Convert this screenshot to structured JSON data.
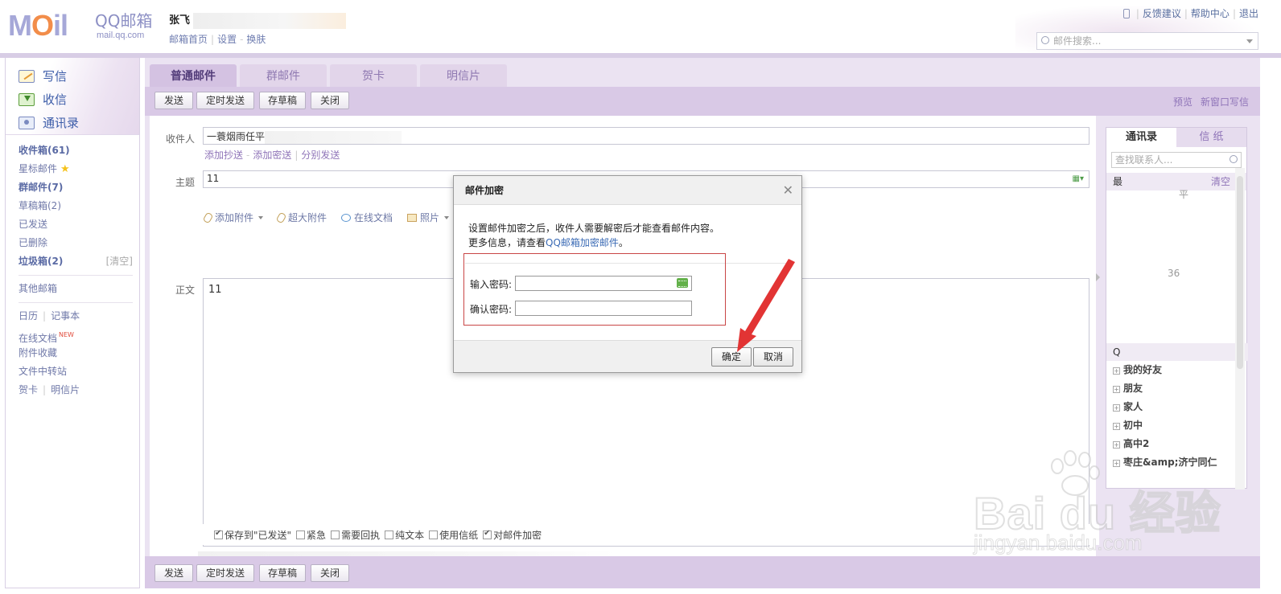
{
  "header": {
    "logo_text": "MOil",
    "logo_brand": "QQ邮箱",
    "logo_domain": "mail.qq.com",
    "user_name": "张飞",
    "user_links": [
      "邮箱首页",
      "设置",
      "换肤"
    ],
    "top_links": [
      "反馈建议",
      "帮助中心",
      "退出"
    ],
    "search_placeholder": "邮件搜索..."
  },
  "sidebar": {
    "actions": [
      {
        "label": "写信",
        "icon": "write-icon"
      },
      {
        "label": "收信",
        "icon": "inbox-icon"
      },
      {
        "label": "通讯录",
        "icon": "contacts-icon"
      }
    ],
    "folders": [
      {
        "label": "收件箱(61)",
        "bold": true
      },
      {
        "label": "星标邮件",
        "icon": "star-icon"
      },
      {
        "label": "群邮件(7)",
        "bold": true
      },
      {
        "label": "草稿箱(2)"
      },
      {
        "label": "已发送"
      },
      {
        "label": "已删除"
      },
      {
        "label": "垃圾箱(2)",
        "bold": true,
        "extra": "[清空]"
      }
    ],
    "other_mailbox": "其他邮箱",
    "tools": {
      "calendar": "日历",
      "notebook": "记事本",
      "online_docs": "在线文档",
      "new_badge": "NEW",
      "attachments": "附件收藏",
      "file_transfer": "文件中转站",
      "greeting_card": "贺卡",
      "postcard": "明信片"
    }
  },
  "tabs": [
    {
      "label": "普通邮件",
      "active": true
    },
    {
      "label": "群邮件",
      "active": false
    },
    {
      "label": "贺卡",
      "active": false
    },
    {
      "label": "明信片",
      "active": false
    }
  ],
  "toolbar": {
    "send": "发送",
    "schedule": "定时发送",
    "save_draft": "存草稿",
    "close": "关闭",
    "preview": "预览",
    "new_window": "新窗口写信"
  },
  "compose": {
    "to_label": "收件人",
    "to_value": "一蓑烟雨任平",
    "add_cc": "添加抄送",
    "add_bcc": "添加密送",
    "separate_send": "分别发送",
    "subject_label": "主题",
    "subject_value": "11",
    "attach": "添加附件",
    "big_attach": "超大附件",
    "online_doc": "在线文档",
    "photo": "照片",
    "body_label": "正文",
    "body_value": "11"
  },
  "options": [
    {
      "label": "保存到\"已发送\"",
      "checked": true
    },
    {
      "label": "紧急",
      "checked": false
    },
    {
      "label": "需要回执",
      "checked": false
    },
    {
      "label": "纯文本",
      "checked": false
    },
    {
      "label": "使用信纸",
      "checked": false
    },
    {
      "label": "对邮件加密",
      "checked": true
    }
  ],
  "contacts": {
    "tab_contacts": "通讯录",
    "tab_stationery": "信 纸",
    "search_placeholder": "查找联系人...",
    "recent_label": "最",
    "clear": "清空",
    "fragment_1": "平",
    "fragment_2": "36",
    "qq_label": "Q",
    "groups": [
      "我的好友",
      "朋友",
      "家人",
      "初中",
      "高中2",
      "枣庄&amp;济宁同仁"
    ]
  },
  "modal": {
    "title": "邮件加密",
    "line1": "设置邮件加密之后，收件人需要解密后才能查看邮件内容。",
    "line2_prefix": "更多信息，请查看",
    "line2_link": "QQ邮箱加密邮件",
    "line2_suffix": "。",
    "password_label": "输入密码:",
    "confirm_label": "确认密码:",
    "ok": "确定",
    "cancel": "取消"
  },
  "watermark": {
    "brand": "Bai du 经验",
    "url": "jingyan.baidu.com"
  },
  "colors": {
    "accent_purple": "#d9c9e6",
    "link_blue": "#3b6bb5",
    "highlight_red": "#c94646"
  }
}
